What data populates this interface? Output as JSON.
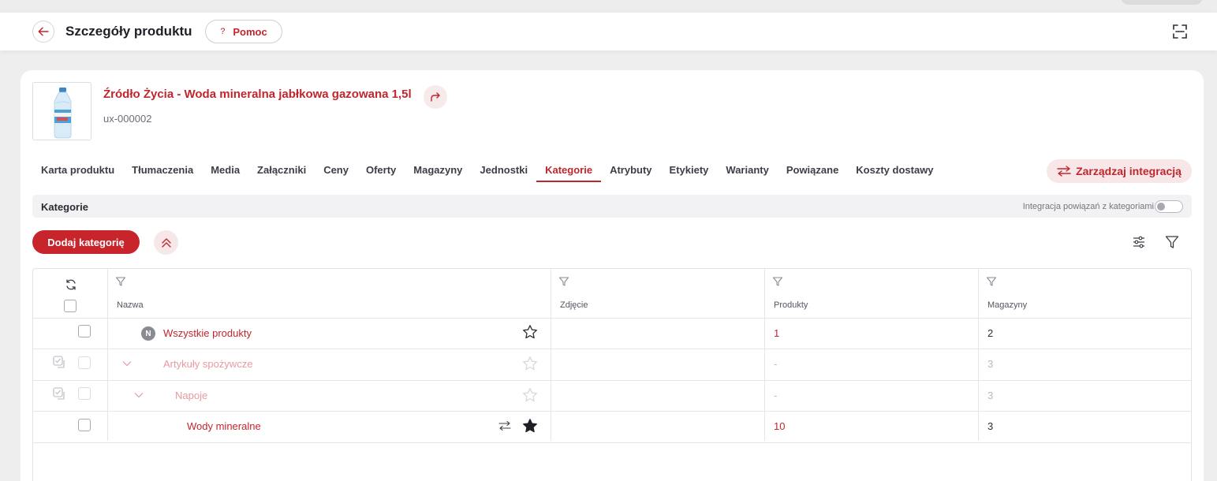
{
  "header": {
    "title": "Szczegóły produktu",
    "help_label": "Pomoc",
    "help_glyph": "?"
  },
  "product": {
    "name": "Źródło Życia - Woda mineralna jabłkowa gazowana 1,5l",
    "sku": "ux-000002"
  },
  "tabs": [
    {
      "label": "Karta produktu"
    },
    {
      "label": "Tłumaczenia"
    },
    {
      "label": "Media"
    },
    {
      "label": "Załączniki"
    },
    {
      "label": "Ceny"
    },
    {
      "label": "Oferty"
    },
    {
      "label": "Magazyny"
    },
    {
      "label": "Jednostki"
    },
    {
      "label": "Kategorie",
      "active": true
    },
    {
      "label": "Atrybuty"
    },
    {
      "label": "Etykiety"
    },
    {
      "label": "Warianty"
    },
    {
      "label": "Powiązane"
    },
    {
      "label": "Koszty dostawy"
    }
  ],
  "integration_button": "Zarządzaj integracją",
  "section": {
    "title": "Kategorie",
    "toggle_label": "Integracja powiązań z kategoriami",
    "toggle_on": false
  },
  "add_category_button": "Dodaj kategorię",
  "table": {
    "columns": [
      "Nazwa",
      "Zdjęcie",
      "Produkty",
      "Magazyny"
    ],
    "rows": [
      {
        "name": "Wszystkie produkty",
        "badge": "N",
        "products": "1",
        "warehouses": "2",
        "starred": false,
        "inherited": false
      },
      {
        "name": "Artykuły spożywcze",
        "products": "-",
        "warehouses": "3",
        "starred": false,
        "inherited": true
      },
      {
        "name": "Napoje",
        "products": "-",
        "warehouses": "3",
        "starred": false,
        "inherited": true
      },
      {
        "name": "Wody mineralne",
        "products": "10",
        "warehouses": "3",
        "starred": true,
        "inherited": false
      }
    ]
  },
  "colors": {
    "accent": "#c0262d",
    "accent_light": "#f7e7e8",
    "faded_accent": "#e79aa0"
  },
  "icons": {
    "back": "arrow-left-icon",
    "fullscreen": "fullscreen-icon",
    "share": "share-arrow-icon",
    "integration": "swap-arrows-icon",
    "collapse": "double-chevron-up-icon",
    "settings": "sliders-icon",
    "filter": "filter-icon",
    "refresh": "refresh-icon",
    "star": "star-icon"
  }
}
